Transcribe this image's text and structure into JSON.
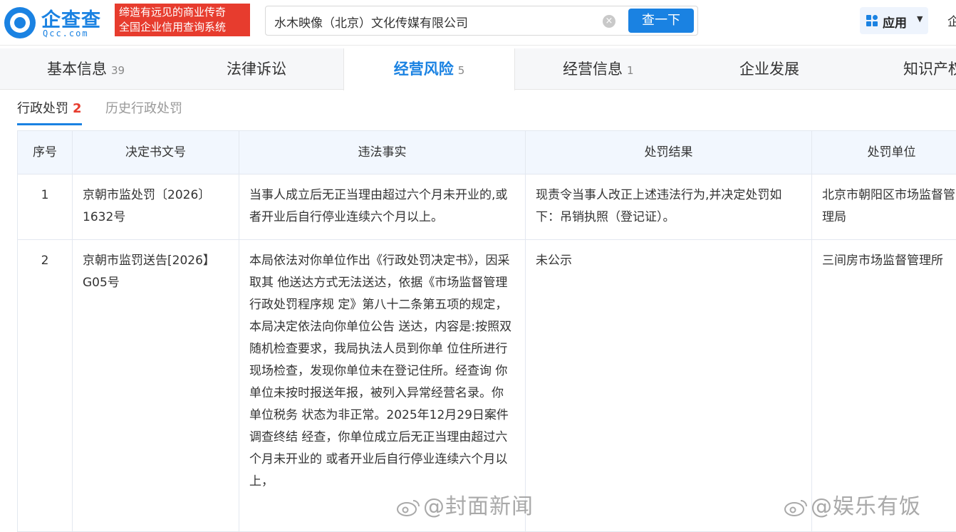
{
  "header": {
    "logo_text": "企查查",
    "logo_sub": "Qcc.com",
    "slogan_line1": "缔造有远见的商业传奇",
    "slogan_line2": "全国企业信用查询系统",
    "search_value": "水木映像（北京）文化传媒有限公司",
    "search_button": "查一下",
    "app_label": "应用",
    "cut_text": "企"
  },
  "tabs": [
    {
      "label": "基本信息",
      "count": "39"
    },
    {
      "label": "法律诉讼",
      "count": ""
    },
    {
      "label": "经营风险",
      "count": "5"
    },
    {
      "label": "经营信息",
      "count": "1"
    },
    {
      "label": "企业发展",
      "count": ""
    },
    {
      "label": "知识产权",
      "count": ""
    }
  ],
  "subtabs": {
    "active_label": "行政处罚",
    "active_count": "2",
    "history_label": "历史行政处罚"
  },
  "table": {
    "headers": [
      "序号",
      "决定书文号",
      "违法事实",
      "处罚结果",
      "处罚单位"
    ],
    "rows": [
      {
        "no": "1",
        "doc_no": "京朝市监处罚〔2026〕1632号",
        "facts": "当事人成立后无正当理由超过六个月未开业的,或者开业后自行停业连续六个月以上。",
        "result": "现责令当事人改正上述违法行为,并决定处罚如下：吊销执照（登记证）。",
        "unit": "北京市朝阳区市场监督管理局"
      },
      {
        "no": "2",
        "doc_no": "京朝市监罚送告[2026】G05号",
        "facts": "本局依法对你单位作出《行政处罚决定书》，因采取其 他送达方式无法送达，依据《市场监督管理行政处罚程序规 定》第八十二条第五项的规定，本局决定依法向你单位公告 送达，内容是:按照双随机检查要求，我局执法人员到你单 位住所进行现场检查，发现你单位未在登记住所。经查询 你单位未按时报送年报，被列入异常经营名录。你单位税务 状态为非正常。2025年12月29日案件调查终结 经查，你单位成立后无正当理由超过六个月未开业的 或者开业后自行停业连续六个月以上，",
        "result": "未公示",
        "unit": "三间房市场监督管理所"
      }
    ]
  },
  "watermarks": [
    "@封面新闻",
    "@娱乐有饭"
  ],
  "colors": {
    "accent": "#1a82e2",
    "brand_red": "#e73c2e",
    "header_bg": "#f2f7fe"
  }
}
